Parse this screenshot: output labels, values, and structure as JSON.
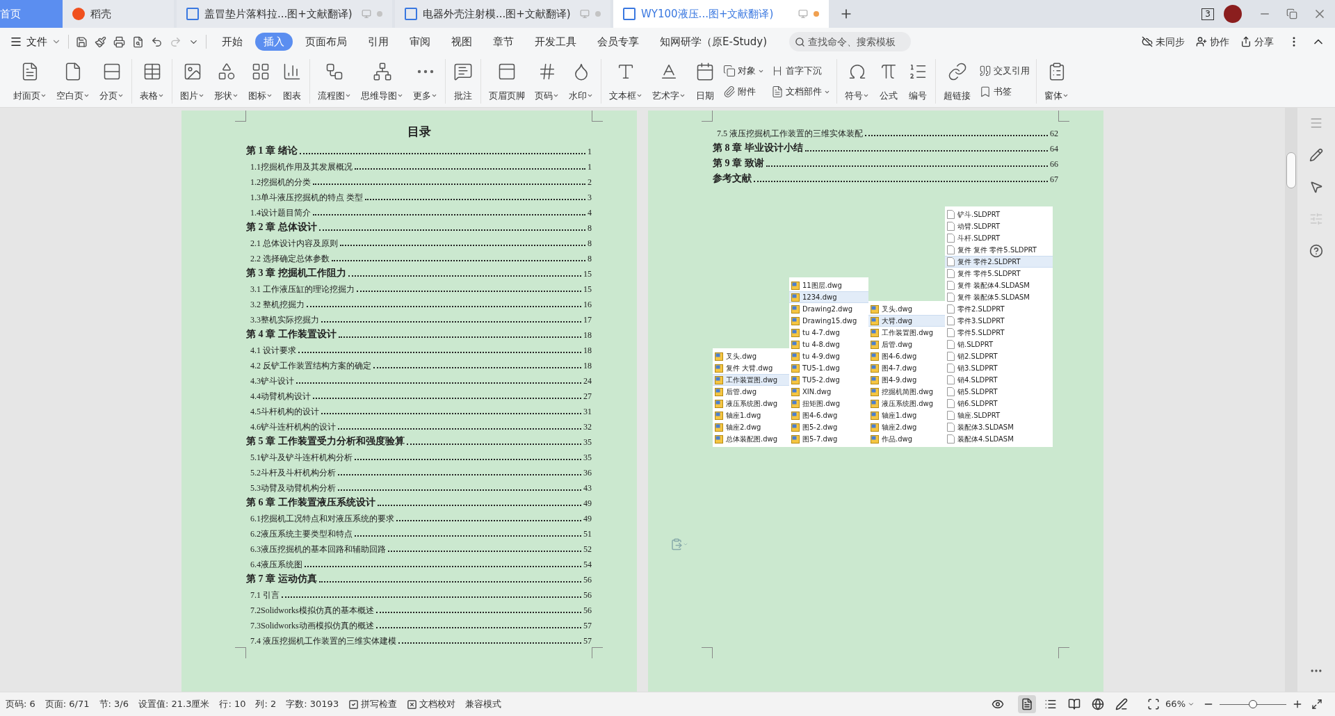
{
  "tabs": [
    {
      "label": "首页",
      "kind": "home"
    },
    {
      "label": "稻壳",
      "kind": "store",
      "selected": false
    },
    {
      "label": "盖冒垫片落料拉...图+文献翻译)",
      "kind": "doc",
      "selected": false,
      "modified": false
    },
    {
      "label": "电器外壳注射模...图+文献翻译)",
      "kind": "doc",
      "selected": false,
      "modified": false
    },
    {
      "label": "WY100液压...图+文献翻译)",
      "kind": "doc",
      "selected": true,
      "modified": true
    }
  ],
  "window_count": "3",
  "menu": {
    "file": "文件",
    "tabs": [
      {
        "label": "开始",
        "selected": false
      },
      {
        "label": "插入",
        "selected": true
      },
      {
        "label": "页面布局",
        "selected": false
      },
      {
        "label": "引用",
        "selected": false
      },
      {
        "label": "审阅",
        "selected": false
      },
      {
        "label": "视图",
        "selected": false
      },
      {
        "label": "章节",
        "selected": false
      },
      {
        "label": "开发工具",
        "selected": false
      },
      {
        "label": "会员专享",
        "selected": false
      },
      {
        "label": "知网研学（原E-Study)",
        "selected": false
      }
    ],
    "search": {
      "placeholder": "查找命令、搜索模板"
    },
    "actions": [
      "未同步",
      "协作",
      "分享"
    ]
  },
  "ribbon": [
    {
      "items": [
        {
          "kind": "large",
          "label": "封面页",
          "dropdown": true
        },
        {
          "kind": "large",
          "label": "空白页",
          "dropdown": true
        },
        {
          "kind": "large",
          "label": "分页",
          "dropdown": true
        }
      ]
    },
    {
      "items": [
        {
          "kind": "large",
          "label": "表格",
          "dropdown": true
        }
      ]
    },
    {
      "items": [
        {
          "kind": "large",
          "label": "图片",
          "dropdown": true
        },
        {
          "kind": "large",
          "label": "形状",
          "dropdown": true
        },
        {
          "kind": "large",
          "label": "图标",
          "dropdown": true
        },
        {
          "kind": "large",
          "label": "图表",
          "dropdown": false
        }
      ]
    },
    {
      "items": [
        {
          "kind": "large",
          "label": "流程图",
          "dropdown": true
        },
        {
          "kind": "large",
          "label": "思维导图",
          "dropdown": true
        },
        {
          "kind": "large",
          "label": "更多",
          "dropdown": true
        }
      ]
    },
    {
      "items": [
        {
          "kind": "large",
          "label": "批注",
          "dropdown": false
        }
      ]
    },
    {
      "items": [
        {
          "kind": "large",
          "label": "页眉页脚",
          "dropdown": false
        },
        {
          "kind": "large",
          "label": "页码",
          "dropdown": true
        },
        {
          "kind": "large",
          "label": "水印",
          "dropdown": true
        }
      ]
    },
    {
      "items": [
        {
          "kind": "large",
          "label": "文本框",
          "dropdown": true
        },
        {
          "kind": "large",
          "label": "艺术字",
          "dropdown": true
        },
        {
          "kind": "large",
          "label": "日期",
          "dropdown": false
        },
        {
          "kind": "stack",
          "items": [
            {
              "label": "对象",
              "dropdown": true
            },
            {
              "label": "附件",
              "dropdown": false
            }
          ]
        },
        {
          "kind": "stack",
          "items": [
            {
              "label": "首字下沉",
              "dropdown": false
            },
            {
              "label": "文档部件",
              "dropdown": true
            }
          ]
        }
      ]
    },
    {
      "items": [
        {
          "kind": "large",
          "label": "符号",
          "dropdown": true
        },
        {
          "kind": "large",
          "label": "公式",
          "dropdown": false
        },
        {
          "kind": "large",
          "label": "编号",
          "dropdown": false
        }
      ]
    },
    {
      "items": [
        {
          "kind": "large",
          "label": "超链接",
          "dropdown": false
        },
        {
          "kind": "stack",
          "items": [
            {
              "label": "交叉引用",
              "dropdown": false
            },
            {
              "label": "书签",
              "dropdown": false
            }
          ]
        }
      ]
    },
    {
      "items": [
        {
          "kind": "large",
          "label": "窗体",
          "dropdown": true
        }
      ]
    }
  ],
  "left_page": {
    "title": "目录",
    "chapters": [
      {
        "title": "第 1 章  绪论",
        "page": "1",
        "children": [
          {
            "title": "1.1挖掘机作用及其发展概况",
            "page": "1"
          },
          {
            "title": "1.2挖掘机的分类",
            "page": "2"
          },
          {
            "title": "1.3单斗液压挖掘机的特点 类型",
            "page": "3"
          },
          {
            "title": "1.4设计题目简介",
            "page": "4"
          }
        ]
      },
      {
        "title": "第 2 章  总体设计",
        "page": "8",
        "children": [
          {
            "title": "2.1 总体设计内容及原则",
            "page": "8"
          },
          {
            "title": "2.2 选择确定总体参数",
            "page": "8"
          }
        ]
      },
      {
        "title": "第 3 章  挖掘机工作阻力",
        "page": "15",
        "children": [
          {
            "title": "3.1 工作液压缸的理论挖掘力",
            "page": "15"
          },
          {
            "title": "3.2 整机挖掘力",
            "page": "16"
          },
          {
            "title": "3.3整机实际挖掘力",
            "page": "17"
          }
        ]
      },
      {
        "title": "第 4 章  工作装置设计",
        "page": "18",
        "children": [
          {
            "title": "4.1 设计要求",
            "page": "18"
          },
          {
            "title": "4.2 反铲工作装置结构方案的确定",
            "page": "18"
          },
          {
            "title": "4.3铲斗设计",
            "page": "24"
          },
          {
            "title": "4.4动臂机构设计",
            "page": "27"
          },
          {
            "title": "4.5斗杆机构的设计",
            "page": "31"
          },
          {
            "title": "4.6铲斗连杆机构的设计",
            "page": "32"
          }
        ]
      },
      {
        "title": "第 5 章  工作装置受力分析和强度验算",
        "page": "35",
        "children": [
          {
            "title": "5.1铲斗及铲斗连杆机构分析",
            "page": "35"
          },
          {
            "title": "5.2斗杆及斗杆机构分析",
            "page": "36"
          },
          {
            "title": "5.3动臂及动臂机构分析",
            "page": "43"
          }
        ]
      },
      {
        "title": "第 6 章  工作装置液压系统设计",
        "page": "49",
        "children": [
          {
            "title": "6.1挖掘机工况特点和对液压系统的要求",
            "page": "49"
          },
          {
            "title": "6.2液压系统主要类型和特点",
            "page": "51"
          },
          {
            "title": "6.3液压挖掘机的基本回路和辅助回路",
            "page": "52"
          },
          {
            "title": "6.4液压系统图",
            "page": "54"
          }
        ]
      },
      {
        "title": "第 7 章  运动仿真",
        "page": "56",
        "children": [
          {
            "title": "7.1 引言",
            "page": "56"
          },
          {
            "title": "7.2Solidworks模拟仿真的基本概述",
            "page": "56"
          },
          {
            "title": "7.3Solidworks动画模拟仿真的概述",
            "page": "57"
          },
          {
            "title": "7.4 液压挖掘机工作装置的三维实体建模",
            "page": "57"
          }
        ]
      }
    ]
  },
  "right_page": {
    "continued_sections": [
      {
        "title": "7.5 液压挖掘机工作装置的三维实体装配",
        "page": "62"
      }
    ],
    "chapters": [
      {
        "title": "第 8 章  毕业设计小结",
        "page": "64"
      },
      {
        "title": "第 9 章  致谢",
        "page": "66"
      },
      {
        "title": "参考文献",
        "page": "67"
      }
    ],
    "file_lists": [
      {
        "kind": "drawing",
        "files": [
          {
            "name": "叉头.dwg",
            "selected": false
          },
          {
            "name": "复件 大臂.dwg",
            "selected": false
          },
          {
            "name": "工作装置图.dwg",
            "selected": true
          },
          {
            "name": "后管.dwg",
            "selected": false
          },
          {
            "name": "液压系统图.dwg",
            "selected": false
          },
          {
            "name": "轴座1.dwg",
            "selected": false
          },
          {
            "name": "轴座2.dwg",
            "selected": false
          },
          {
            "name": "总体装配图.dwg",
            "selected": false
          }
        ]
      },
      {
        "kind": "drawing",
        "files": [
          {
            "name": "11图层.dwg",
            "selected": false
          },
          {
            "name": "1234.dwg",
            "selected": true
          },
          {
            "name": "Drawing2.dwg",
            "selected": false
          },
          {
            "name": "Drawing15.dwg",
            "selected": false
          },
          {
            "name": "tu 4-7.dwg",
            "selected": false
          },
          {
            "name": "tu 4-8.dwg",
            "selected": false
          },
          {
            "name": "tu 4-9.dwg",
            "selected": false
          },
          {
            "name": "TU5-1.dwg",
            "selected": false
          },
          {
            "name": "TU5-2.dwg",
            "selected": false
          },
          {
            "name": "XIN.dwg",
            "selected": false
          },
          {
            "name": "扭矩图.dwg",
            "selected": false
          },
          {
            "name": "图4-6.dwg",
            "selected": false
          },
          {
            "name": "图5-2.dwg",
            "selected": false
          },
          {
            "name": "图5-7.dwg",
            "selected": false
          }
        ]
      },
      {
        "kind": "drawing",
        "files": [
          {
            "name": "叉头.dwg",
            "selected": false
          },
          {
            "name": "大臂.dwg",
            "selected": true
          },
          {
            "name": "工作装置图.dwg",
            "selected": false
          },
          {
            "name": "后管.dwg",
            "selected": false
          },
          {
            "name": "图4-6.dwg",
            "selected": false
          },
          {
            "name": "图4-7.dwg",
            "selected": false
          },
          {
            "name": "图4-9.dwg",
            "selected": false
          },
          {
            "name": "挖掘机简图.dwg",
            "selected": false
          },
          {
            "name": "液压系统图.dwg",
            "selected": false
          },
          {
            "name": "轴座1.dwg",
            "selected": false
          },
          {
            "name": "轴座2.dwg",
            "selected": false
          },
          {
            "name": "作品.dwg",
            "selected": false
          }
        ]
      },
      {
        "kind": "part",
        "files": [
          {
            "name": "铲斗.SLDPRT",
            "selected": false
          },
          {
            "name": "动臂.SLDPRT",
            "selected": false
          },
          {
            "name": "斗杆.SLDPRT",
            "selected": false
          },
          {
            "name": "复件 复件 零件5.SLDPRT",
            "selected": false
          },
          {
            "name": "复件 零件2.SLDPRT",
            "selected": true
          },
          {
            "name": "复件 零件5.SLDPRT",
            "selected": false
          },
          {
            "name": "复件 装配体4.SLDASM",
            "selected": false
          },
          {
            "name": "复件 装配体5.SLDASM",
            "selected": false
          },
          {
            "name": "零件2.SLDPRT",
            "selected": false
          },
          {
            "name": "零件3.SLDPRT",
            "selected": false
          },
          {
            "name": "零件5.SLDPRT",
            "selected": false
          },
          {
            "name": "销.SLDPRT",
            "selected": false
          },
          {
            "name": "销2.SLDPRT",
            "selected": false
          },
          {
            "name": "销3.SLDPRT",
            "selected": false
          },
          {
            "name": "销4.SLDPRT",
            "selected": false
          },
          {
            "name": "销5.SLDPRT",
            "selected": false
          },
          {
            "name": "销6.SLDPRT",
            "selected": false
          },
          {
            "name": "轴座.SLDPRT",
            "selected": false
          },
          {
            "name": "装配体3.SLDASM",
            "selected": false
          },
          {
            "name": "装配体4.SLDASM",
            "selected": false
          }
        ]
      }
    ]
  },
  "status": [
    {
      "kind": "text",
      "label": "页码: 6"
    },
    {
      "kind": "text",
      "label": "页面: 6/71"
    },
    {
      "kind": "text",
      "label": "节: 3/6"
    },
    {
      "kind": "text",
      "label": "设置值: 21.3厘米"
    },
    {
      "kind": "text",
      "label": "行: 10"
    },
    {
      "kind": "text",
      "label": "列: 2"
    },
    {
      "kind": "text",
      "label": "字数: 30193"
    },
    {
      "kind": "spell",
      "label": "拼写检查"
    },
    {
      "kind": "proof",
      "label": "文档校对"
    },
    {
      "kind": "text",
      "label": "兼容模式"
    }
  ],
  "view_modes": [
    {
      "selected": true
    },
    {
      "selected": false
    },
    {
      "selected": false
    },
    {
      "selected": false
    },
    {
      "selected": false
    }
  ],
  "zoom": {
    "label": "66%",
    "level": 0.5
  }
}
